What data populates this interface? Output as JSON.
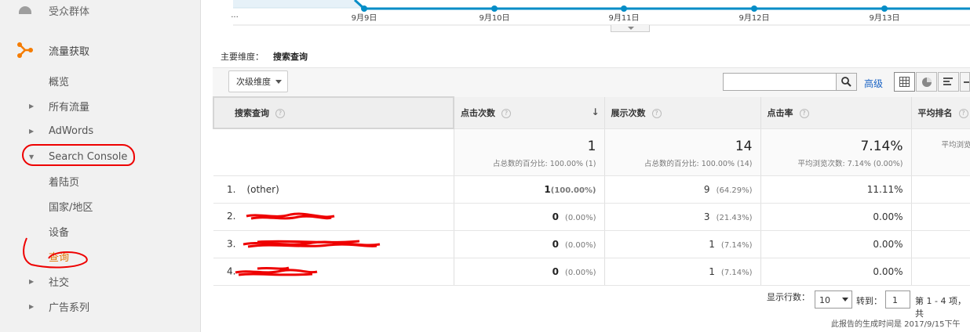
{
  "sidebar": {
    "top_partial": "受众群体",
    "acquisition": "流量获取",
    "items": [
      {
        "label": "概览",
        "arrow": ""
      },
      {
        "label": "所有流量",
        "arrow": "▶"
      },
      {
        "label": "AdWords",
        "arrow": "▶"
      },
      {
        "label": "Search Console",
        "arrow": "▼"
      },
      {
        "label": "着陆页",
        "arrow": ""
      },
      {
        "label": "国家/地区",
        "arrow": ""
      },
      {
        "label": "设备",
        "arrow": ""
      },
      {
        "label": "查询",
        "arrow": "",
        "active": true
      },
      {
        "label": "社交",
        "arrow": "▶"
      },
      {
        "label": "广告系列",
        "arrow": "▶"
      }
    ]
  },
  "chart": {
    "ellipsis": "...",
    "ticks": [
      "9月9日",
      "9月10日",
      "9月11日",
      "9月12日",
      "9月13日"
    ]
  },
  "primary_dimension": {
    "label": "主要维度：",
    "value": "搜索查询"
  },
  "toolbar": {
    "secondary_dimension": "次级维度",
    "search_value": "",
    "advanced": "高级"
  },
  "table": {
    "headers": [
      "搜索查询",
      "点击次数",
      "展示次数",
      "点击率",
      "平均排名"
    ],
    "help": "?",
    "sort_arrow": "↓",
    "totals": [
      {
        "value": "1",
        "sub": "占总数的百分比: 100.00% (1)"
      },
      {
        "value": "14",
        "sub": "占总数的百分比: 100.00% (14)"
      },
      {
        "value": "7.14%",
        "sub": "平均浏览次数: 7.14% (0.00%)"
      },
      {
        "value": "",
        "sub": "平均浏览"
      }
    ],
    "rows": [
      {
        "index": "1.",
        "query": "(other)",
        "clicks": "1",
        "clicks_pct": "(100.00%)",
        "impr": "9",
        "impr_pct": "(64.29%)",
        "ctr": "11.11%"
      },
      {
        "index": "2.",
        "query": "",
        "clicks": "0",
        "clicks_pct": "(0.00%)",
        "impr": "3",
        "impr_pct": "(21.43%)",
        "ctr": "0.00%"
      },
      {
        "index": "3.",
        "query": "",
        "clicks": "0",
        "clicks_pct": "(0.00%)",
        "impr": "1",
        "impr_pct": "(7.14%)",
        "ctr": "0.00%"
      },
      {
        "index": "4.",
        "query": "",
        "clicks": "0",
        "clicks_pct": "(0.00%)",
        "impr": "1",
        "impr_pct": "(7.14%)",
        "ctr": "0.00%"
      }
    ]
  },
  "pagination": {
    "rows_label": "显示行数：",
    "rows_value": "10",
    "goto_label": "转到：",
    "goto_value": "1",
    "range": "第 1 - 4 项，共"
  },
  "generated": "此报告的生成时间是 2017/9/15下午",
  "colors": {
    "accent": "#e37400",
    "line": "#058dc7",
    "link": "#1a63c4",
    "annotation": "#e00000"
  }
}
